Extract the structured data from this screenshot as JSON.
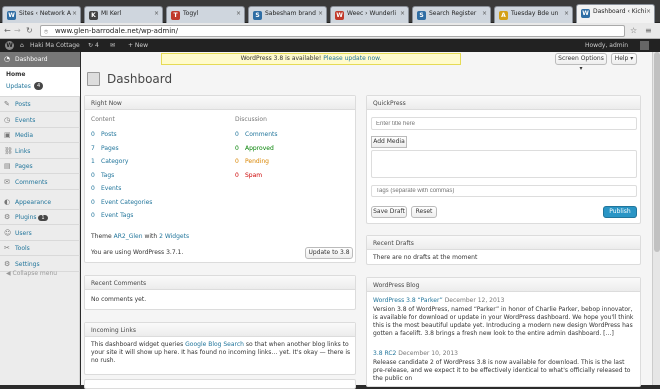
{
  "browser": {
    "tabs": [
      {
        "label": "Sites ‹ Network A",
        "color": "#2e6da4",
        "glyph": "W"
      },
      {
        "label": "MI Kerl",
        "color": "#444",
        "glyph": "K"
      },
      {
        "label": "Togyl",
        "color": "#c0392b",
        "glyph": "T"
      },
      {
        "label": "Sabesham brand",
        "color": "#2e6da4",
        "glyph": "S"
      },
      {
        "label": "Weec › Wunderli",
        "color": "#c0392b",
        "glyph": "W"
      },
      {
        "label": "Search Register",
        "color": "#2e6da4",
        "glyph": "S"
      },
      {
        "label": "Tuesday Bde un",
        "color": "#d4a017",
        "glyph": "A"
      },
      {
        "label": "Dashboard ‹ Kichi",
        "color": "#2e6da4",
        "glyph": "W"
      }
    ],
    "url": "www.glen-barrodale.net/wp-admin/",
    "back": "←",
    "forward": "→",
    "reload": "↻",
    "star": "☆",
    "menu": "≡"
  },
  "adminbar": {
    "wp": "W",
    "site": "Haki Ma Cottage",
    "updates": "4",
    "comments": "0",
    "new": "+ New",
    "howdy": "Howdy, admin"
  },
  "sidebar": {
    "dashboard": "Dashboard",
    "home": "Home",
    "updates": "Updates",
    "updates_count": "4",
    "items": [
      {
        "label": "Posts",
        "icon": "✎"
      },
      {
        "label": "Events",
        "icon": "◷"
      },
      {
        "label": "Media",
        "icon": "▣"
      },
      {
        "label": "Links",
        "icon": "⛓"
      },
      {
        "label": "Pages",
        "icon": "▤"
      },
      {
        "label": "Comments",
        "icon": "✉"
      },
      {
        "label": "Appearance",
        "icon": "◐"
      },
      {
        "label": "Plugins",
        "icon": "⚙",
        "badge": "1"
      },
      {
        "label": "Users",
        "icon": "☺"
      },
      {
        "label": "Tools",
        "icon": "✂"
      },
      {
        "label": "Settings",
        "icon": "⚙"
      }
    ],
    "collapse": "Collapse menu"
  },
  "page": {
    "nag": "WordPress 3.8 is available!",
    "nag_link": "Please update now.",
    "title": "Dashboard",
    "screen_options": "Screen Options ▾",
    "help": "Help ▾"
  },
  "right_now": {
    "title": "Right Now",
    "content": "Content",
    "discussion": "Discussion",
    "content_rows": [
      {
        "n": "0",
        "l": "Posts"
      },
      {
        "n": "7",
        "l": "Pages"
      },
      {
        "n": "1",
        "l": "Category"
      },
      {
        "n": "0",
        "l": "Tags"
      },
      {
        "n": "0",
        "l": "Events"
      },
      {
        "n": "0",
        "l": "Event Categories"
      },
      {
        "n": "0",
        "l": "Event Tags"
      }
    ],
    "discussion_rows": [
      {
        "n": "0",
        "l": "Comments",
        "c": "#21759b"
      },
      {
        "n": "0",
        "l": "Approved",
        "c": "#008000"
      },
      {
        "n": "0",
        "l": "Pending",
        "c": "#d98500"
      },
      {
        "n": "0",
        "l": "Spam",
        "c": "#c00"
      }
    ],
    "theme_prefix": "Theme",
    "theme": "AR2_Glen",
    "theme_with": "with",
    "widgets": "2 Widgets",
    "version": "You are using WordPress 3.7.1.",
    "update_btn": "Update to 3.8"
  },
  "recent_comments": {
    "title": "Recent Comments",
    "empty": "No comments yet."
  },
  "incoming": {
    "title": "Incoming Links",
    "text": "This dashboard widget queries",
    "link": "Google Blog Search",
    "text2": "so that when another blog links to your site it will show up here. It has found no incoming links… yet. It's okay — there is no rush."
  },
  "quickpress": {
    "title": "QuickPress",
    "title_ph": "Enter title here",
    "add_media": "Add Media",
    "tags_ph": "Tags (separate with commas)",
    "save": "Save Draft",
    "reset": "Reset",
    "publish": "Publish"
  },
  "recent_drafts": {
    "title": "Recent Drafts",
    "empty": "There are no drafts at the moment"
  },
  "blog": {
    "title": "WordPress Blog",
    "post1_title": "WordPress 3.8 “Parker”",
    "post1_date": "December 12, 2013",
    "post1_body": "Version 3.8 of WordPress, named “Parker” in honor of Charlie Parker, bebop innovator, is available for download or update in your WordPress dashboard. We hope you'll think this is the most beautiful update yet. Introducing a modern new design WordPress has gotten a facelift. 3.8 brings a fresh new look to the entire admin dashboard. […]",
    "post2_title": "3.8 RC2",
    "post2_date": "December 10, 2013",
    "post2_body": "Release candidate 2 of WordPress 3.8 is now available for download. This is the last pre-release, and we expect it to be effectively identical to what's officially released to the public on"
  }
}
